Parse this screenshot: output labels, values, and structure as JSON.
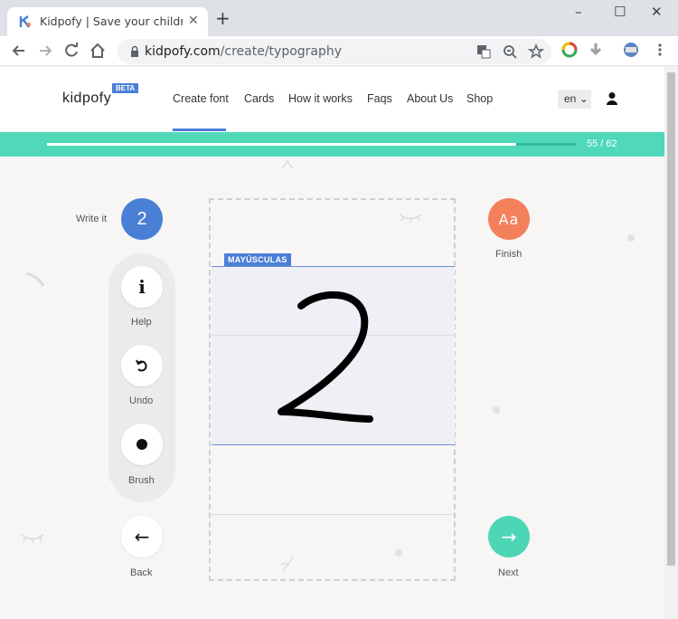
{
  "browser": {
    "tab_title": "Kidpofy | Save your children's c",
    "tab_close": "✕",
    "new_tab": "+",
    "url_domain": "kidpofy.com",
    "url_path": "/create/typography",
    "window_min": "–",
    "window_max": "☐",
    "window_close": "✕"
  },
  "site": {
    "logo": "kidpofy",
    "beta": "BETA",
    "nav": [
      "Create font",
      "Cards",
      "How it works",
      "Faqs",
      "About Us",
      "Shop"
    ],
    "lang": "en",
    "lang_chevron": "⌄"
  },
  "progress": {
    "count": "55 / 62",
    "fraction": 0.887
  },
  "tools": {
    "write_label": "Write it",
    "write_char": "2",
    "help_glyph": "i",
    "help_label": "Help",
    "undo_label": "Undo",
    "brush_label": "Brush",
    "back_label": "Back",
    "back_glyph": "←",
    "finish_glyph": "Aa",
    "finish_label": "Finish",
    "next_glyph": "→",
    "next_label": "Next"
  },
  "canvas": {
    "tag": "MAYÚSCULAS"
  },
  "colors": {
    "accent_blue": "#4a7fd6",
    "teal": "#4fd9b9",
    "finish_orange": "#f47f5b",
    "next_teal": "#4dd6b6"
  }
}
